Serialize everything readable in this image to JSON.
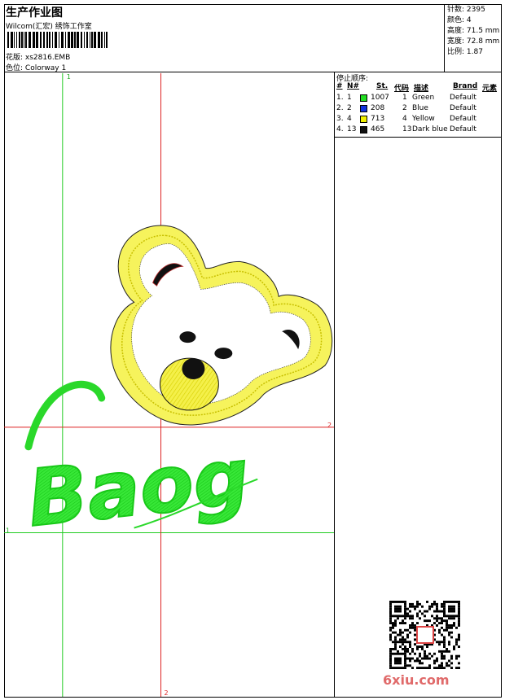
{
  "header": {
    "title": "生产作业图",
    "company": "Wilcom(汇宏) 绣饰工作室",
    "design_label": "花版:",
    "design_value": "xs2816.EMB",
    "colorway_label": "色位:",
    "colorway_value": "Colorway 1"
  },
  "stats": {
    "stitches": "针数: 2395",
    "colors": "颜色: 4",
    "height": "高度: 71.5 mm",
    "width": "宽度: 72.8 mm",
    "ratio": "比例: 1.87"
  },
  "stop_sequence": {
    "title": "停止顺序:",
    "headers": [
      "#",
      "N#",
      "St.",
      "代码",
      "描述",
      "Brand",
      "元素"
    ],
    "rows": [
      {
        "num": "1.",
        "n": "1",
        "color": "#22dd22",
        "st": "1007",
        "code": "1",
        "desc": "Green",
        "brand": "Default"
      },
      {
        "num": "2.",
        "n": "2",
        "color": "#1133dd",
        "st": "208",
        "code": "2",
        "desc": "Blue",
        "brand": "Default"
      },
      {
        "num": "3.",
        "n": "4",
        "color": "#f0f000",
        "st": "713",
        "code": "4",
        "desc": "Yellow",
        "brand": "Default"
      },
      {
        "num": "4.",
        "n": "13",
        "color": "#111111",
        "st": "465",
        "code": "13",
        "desc": "Dark blue",
        "brand": "Default"
      }
    ]
  },
  "guides": {
    "green_label_top": "1",
    "green_label_left": "1",
    "red_label_right": "2",
    "red_label_bottom": "2"
  },
  "embroidery_text": "Baog",
  "watermark": "6xiu.com"
}
